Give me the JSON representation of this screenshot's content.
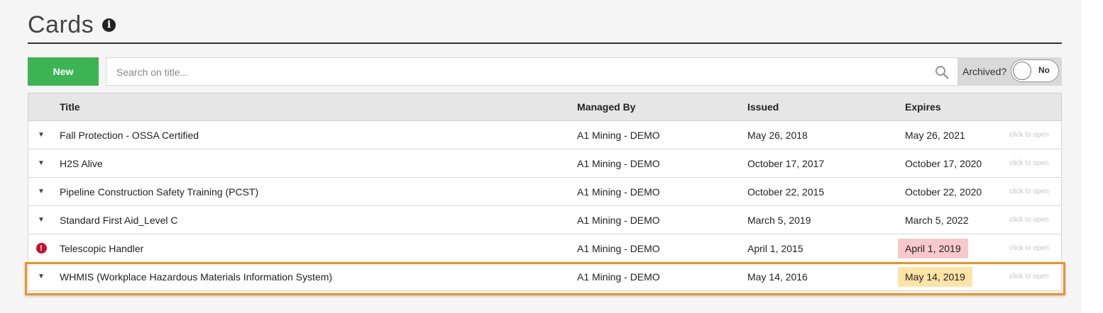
{
  "page": {
    "title": "Cards",
    "info_icon": "info-circle-icon"
  },
  "toolbar": {
    "new_label": "New",
    "search_placeholder": "Search on title...",
    "archived_label": "Archived?",
    "archived_state": "No"
  },
  "table": {
    "headers": {
      "title": "Title",
      "managed_by": "Managed By",
      "issued": "Issued",
      "expires": "Expires"
    },
    "rows": [
      {
        "icon": "caret-down-icon",
        "title": "Fall Protection - OSSA Certified",
        "managed_by": "A1 Mining - DEMO",
        "issued": "May 26, 2018",
        "expires": "May 26, 2021",
        "expires_status": "ok",
        "action": "click to open"
      },
      {
        "icon": "caret-down-icon",
        "title": "H2S Alive",
        "managed_by": "A1 Mining - DEMO",
        "issued": "October 17, 2017",
        "expires": "October 17, 2020",
        "expires_status": "ok",
        "action": "click to open"
      },
      {
        "icon": "caret-down-icon",
        "title": "Pipeline Construction Safety Training (PCST)",
        "managed_by": "A1 Mining - DEMO",
        "issued": "October 22, 2015",
        "expires": "October 22, 2020",
        "expires_status": "ok",
        "action": "click to open"
      },
      {
        "icon": "caret-down-icon",
        "title": "Standard First Aid_Level C",
        "managed_by": "A1 Mining - DEMO",
        "issued": "March 5, 2019",
        "expires": "March 5, 2022",
        "expires_status": "ok",
        "action": "click to open"
      },
      {
        "icon": "alert-icon",
        "title": "Telescopic Handler",
        "managed_by": "A1 Mining - DEMO",
        "issued": "April 1, 2015",
        "expires": "April 1, 2019",
        "expires_status": "expired",
        "action": "click to open"
      },
      {
        "icon": "caret-down-icon",
        "title": "WHMIS (Workplace Hazardous Materials Information System)",
        "managed_by": "A1 Mining - DEMO",
        "issued": "May 14, 2016",
        "expires": "May 14, 2019",
        "expires_status": "expiring",
        "action": "click to open"
      }
    ]
  },
  "colors": {
    "new_button": "#3cb454",
    "expired": "#f7c9cc",
    "expiring": "#fde3a6",
    "highlight": "#f0921e"
  }
}
